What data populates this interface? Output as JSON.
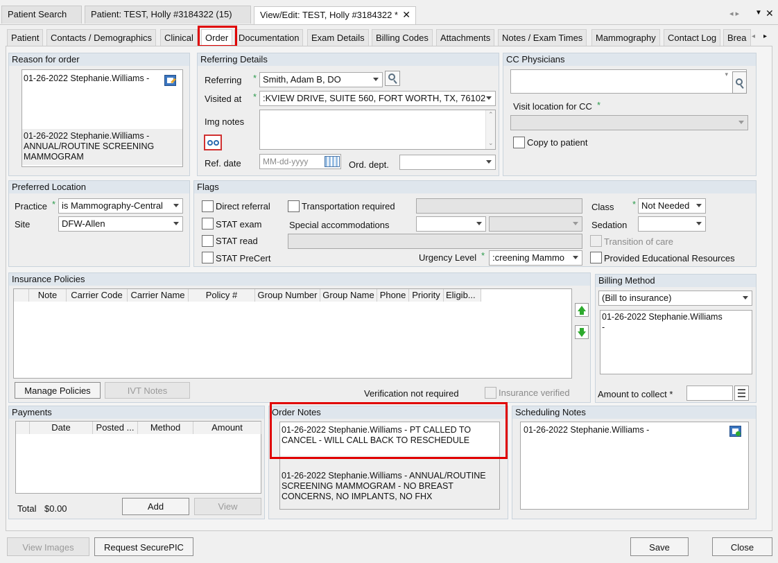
{
  "doc_tabs": [
    "Patient Search",
    "Patient: TEST, Holly #3184322 (15)",
    "View/Edit: TEST, Holly #3184322 *"
  ],
  "sub_tabs": [
    "Patient",
    "Contacts / Demographics",
    "Clinical",
    "Order",
    "Documentation",
    "Exam Details",
    "Billing Codes",
    "Attachments",
    "Notes / Exam Times",
    "Mammography",
    "Contact Log",
    "Brea"
  ],
  "reason": {
    "title": "Reason for order",
    "entry1": "01-26-2022 Stephanie.Williams -",
    "entry2": "01-26-2022 Stephanie.Williams -\nANNUAL/ROUTINE SCREENING\nMAMMOGRAM"
  },
  "referring": {
    "title": "Referring Details",
    "referring_label": "Referring",
    "referring_value": "Smith, Adam B, DO",
    "visited_label": "Visited at",
    "visited_value": ":KVIEW DRIVE, SUITE 560, FORT WORTH, TX, 76102",
    "img_notes_label": "Img notes",
    "ref_date_label": "Ref. date",
    "ref_date_placeholder": "MM-dd-yyyy",
    "ord_dept_label": "Ord. dept."
  },
  "cc": {
    "title": "CC Physicians",
    "visit_label": "Visit location for CC",
    "copy_label": "Copy to patient"
  },
  "preferred": {
    "title": "Preferred Location",
    "practice_label": "Practice",
    "practice_value": "is Mammography-Central",
    "site_label": "Site",
    "site_value": "DFW-Allen"
  },
  "flags": {
    "title": "Flags",
    "direct_referral": "Direct referral",
    "transportation": "Transportation required",
    "stat_exam": "STAT exam",
    "special_acc": "Special accommodations",
    "stat_read": "STAT read",
    "stat_precert": "STAT PreCert",
    "urgency_label": "Urgency Level",
    "urgency_value": ":creening Mammo",
    "class_label": "Class",
    "class_value": "Not Needed",
    "sedation_label": "Sedation",
    "transition": "Transition of care",
    "educational": "Provided Educational Resources"
  },
  "insurance": {
    "title": "Insurance Policies",
    "columns": [
      "Note",
      "Carrier Code",
      "Carrier Name",
      "Policy #",
      "Group Number",
      "Group Name",
      "Phone",
      "Priority",
      "Eligib..."
    ],
    "manage": "Manage Policies",
    "ivt": "IVT Notes",
    "verification": "Verification not required",
    "verified": "Insurance verified"
  },
  "billing": {
    "title": "Billing Method",
    "method": "(Bill to insurance)",
    "note": "01-26-2022 Stephanie.Williams\n-",
    "amount_label": "Amount to collect *"
  },
  "payments": {
    "title": "Payments",
    "columns": [
      "Date",
      "Posted ...",
      "Method",
      "Amount"
    ],
    "total_label": "Total",
    "total_value": "$0.00",
    "add": "Add",
    "view": "View"
  },
  "order_notes": {
    "title": "Order Notes",
    "note1": "01-26-2022 Stephanie.Williams - PT CALLED TO\nCANCEL - WILL CALL BACK TO RESCHEDULE",
    "note2": "01-26-2022 Stephanie.Williams - ANNUAL/ROUTINE\nSCREENING MAMMOGRAM - NO BREAST\nCONCERNS, NO IMPLANTS, NO FHX"
  },
  "scheduling": {
    "title": "Scheduling Notes",
    "note": "01-26-2022 Stephanie.Williams -"
  },
  "footer": {
    "view_images": "View Images",
    "request": "Request SecurePIC",
    "save": "Save",
    "close": "Close"
  },
  "colors": {
    "highlight": "#e00000",
    "required": "#2a9a4a"
  }
}
